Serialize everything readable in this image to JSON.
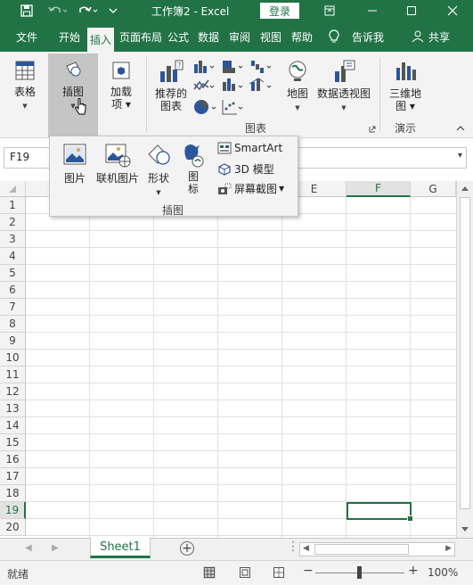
{
  "titlebar": {
    "title": "工作簿2  -  Excel",
    "login": "登录"
  },
  "tabs": [
    "文件",
    "开始",
    "插入",
    "页面布局",
    "公式",
    "数据",
    "审阅",
    "视图",
    "帮助",
    "告诉我",
    "共享"
  ],
  "ribbon": {
    "table": "表格",
    "illustrations": "插图",
    "addins": "加载项",
    "recommended_charts": "推荐的图表",
    "charts_group": "图表",
    "maps": "地图",
    "pivot_chart": "数据透视图",
    "map3d": "三维地图",
    "tours_group": "演示"
  },
  "dropdown": {
    "picture": "图片",
    "online_picture": "联机图片",
    "shapes": "形状",
    "icons": "图标",
    "smartart": "SmartArt",
    "model3d": "3D 模型",
    "screenshot": "屏幕截图",
    "group_label": "插图"
  },
  "namebox": "F19",
  "columns": [
    "E",
    "F",
    "G"
  ],
  "rows": [
    "1",
    "2",
    "3",
    "4",
    "5",
    "6",
    "7",
    "8",
    "9",
    "10",
    "11",
    "12",
    "13",
    "14",
    "15",
    "16",
    "17",
    "18",
    "19",
    "20"
  ],
  "sheet": {
    "tab": "Sheet1",
    "add": "+"
  },
  "status": {
    "ready": "就绪",
    "zoom": "100%"
  },
  "colors": {
    "brand": "#217346",
    "ribbon_bg": "#f3f3f3"
  }
}
